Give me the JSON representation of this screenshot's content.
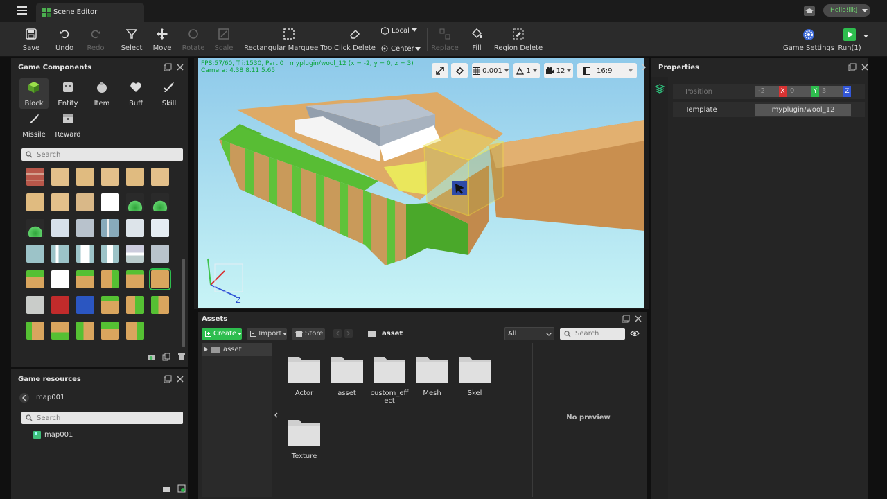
{
  "app": {
    "tab_title": "Scene Editor",
    "user_name": "Hello!likj"
  },
  "toolbar": {
    "save": "Save",
    "undo": "Undo",
    "redo": "Redo",
    "select": "Select",
    "move": "Move",
    "rotate": "Rotate",
    "scale": "Scale",
    "marquee": "Rectangular Marquee Tool",
    "click_delete": "Click Delete",
    "local": "Local",
    "center": "Center",
    "replace": "Replace",
    "fill": "Fill",
    "region_delete": "Region Delete",
    "game_settings": "Game Settings",
    "run": "Run(1)"
  },
  "game_components": {
    "title": "Game Components",
    "items": [
      "Block",
      "Entity",
      "Item",
      "Buff",
      "Skill",
      "Missile",
      "Reward"
    ],
    "selected": "Block",
    "search_placeholder": "Search"
  },
  "game_resources": {
    "title": "Game resources",
    "breadcrumb": "map001",
    "search_placeholder": "Search",
    "items": [
      "map001"
    ]
  },
  "viewport": {
    "stats_line1": "FPS:57/60, Tri:1530, Part 0",
    "stats_path": "myplugin/wool_12 (x = -2, y = 0, z = 3)",
    "stats_line2": "Camera: 4.38 8.11 5.65",
    "grid_value": "0.001",
    "angle_value": "1",
    "camera_value": "12",
    "aspect": "16:9",
    "axis_z": "Z"
  },
  "assets": {
    "title": "Assets",
    "create": "Create",
    "import": "Import",
    "store": "Store",
    "path": "asset",
    "filter": "All",
    "search_placeholder": "Search",
    "tree_root": "asset",
    "folders": [
      "Actor",
      "asset",
      "custom_effect",
      "Mesh",
      "Skel",
      "Texture"
    ],
    "no_preview": "No preview"
  },
  "properties": {
    "title": "Properties",
    "position_label": "Position",
    "pos_x": "-2",
    "pos_y": "0",
    "pos_z": "3",
    "axis_x": "X",
    "axis_y": "Y",
    "axis_z": "Z",
    "template_label": "Template",
    "template_value": "myplugin/wool_12"
  },
  "colors": {
    "accent_green": "#4caf50",
    "selection_yellow": "#f4e83a",
    "sky": "#8ec9ea"
  }
}
